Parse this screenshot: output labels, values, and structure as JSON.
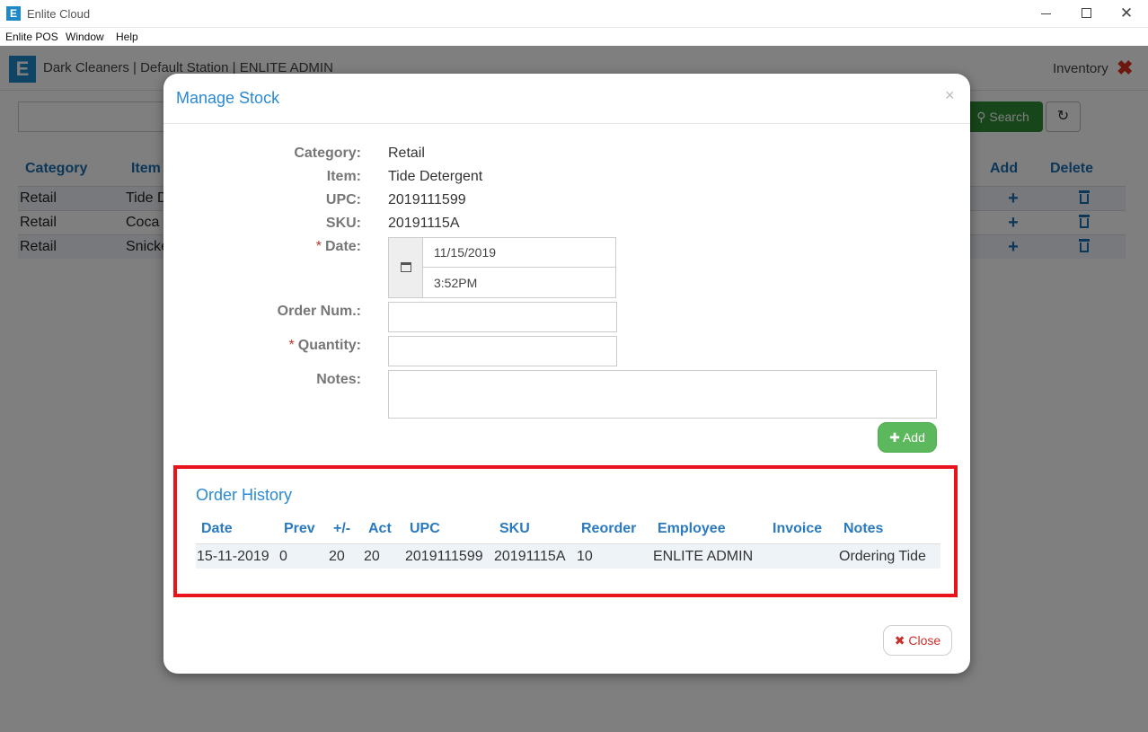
{
  "window": {
    "title": "Enlite Cloud",
    "logo_letter": "E",
    "controls": {
      "close": "✕"
    }
  },
  "menubar": [
    "Enlite POS",
    "Window",
    "Help"
  ],
  "app": {
    "station": "Dark Cleaners | Default Station | ENLITE ADMIN",
    "section": "Inventory",
    "search_label": "Search",
    "columns": [
      "Category",
      "Item",
      "Add",
      "Delete"
    ],
    "rows": [
      {
        "category": "Retail",
        "item": "Tide D"
      },
      {
        "category": "Retail",
        "item": "Coca"
      },
      {
        "category": "Retail",
        "item": "Snicke"
      }
    ]
  },
  "modal": {
    "title": "Manage Stock",
    "close_glyph": "×",
    "fields": {
      "category_label": "Category:",
      "category_value": "Retail",
      "item_label": "Item:",
      "item_value": "Tide Detergent",
      "upc_label": "UPC:",
      "upc_value": "2019111599",
      "sku_label": "SKU:",
      "sku_value": "20191115A",
      "date_label": "Date:",
      "date_value": "11/15/2019",
      "time_value": "3:52PM",
      "order_num_label": "Order Num.:",
      "order_num_value": "",
      "quantity_label": "Quantity:",
      "quantity_value": "",
      "notes_label": "Notes:",
      "notes_value": ""
    },
    "add_button": "Add",
    "close_button": "Close",
    "history": {
      "title": "Order History",
      "columns": [
        "Date",
        "Prev",
        "+/-",
        "Act",
        "UPC",
        "SKU",
        "Reorder",
        "Employee",
        "Invoice",
        "Notes"
      ],
      "rows": [
        {
          "date": "15-11-2019",
          "prev": "0",
          "change": "20",
          "act": "20",
          "upc": "2019111599",
          "sku": "20191115A",
          "reorder": "10",
          "employee": "ENLITE ADMIN",
          "invoice": "",
          "notes": "Ordering Tide"
        }
      ]
    }
  },
  "colors": {
    "accent": "#2a8ad4",
    "success": "#5cb85c",
    "danger": "#c9302c",
    "highlight_border": "#e8131b"
  }
}
